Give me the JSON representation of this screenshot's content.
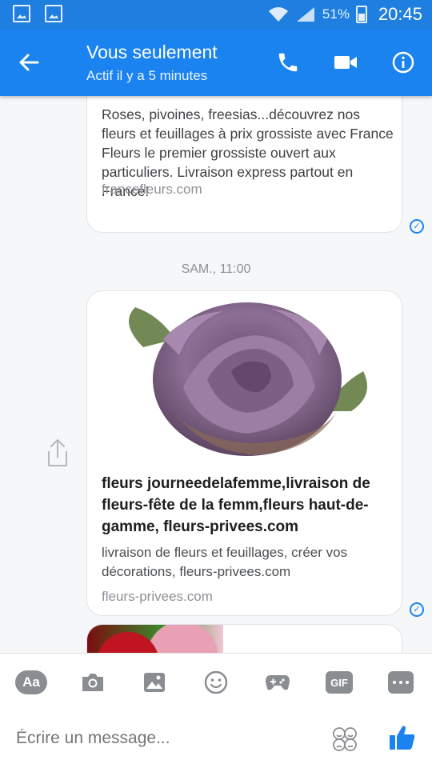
{
  "status_bar": {
    "battery": "51%",
    "time": "20:45"
  },
  "header": {
    "title": "Vous seulement",
    "subtitle": "Actif il y a 5 minutes"
  },
  "messages": [
    {
      "description": "Roses, pivoines, freesias...découvrez nos fleurs et feuillages à prix grossiste avec France Fleurs le premier grossiste ouvert aux particuliers. Livraison express partout en France!",
      "domain": "francefleurs.com"
    },
    {
      "timestamp": "SAM., 11:00",
      "title": "fleurs journeedelafemme,livraison de fleurs-fête de la femm,fleurs haut-de-gamme, fleurs-privees.com",
      "description": "livraison de fleurs et feuillages, créer vos décorations, fleurs-privees.com",
      "domain": "fleurs-privees.com"
    }
  ],
  "composer": {
    "aa_label": "Aa",
    "gif_label": "GIF",
    "placeholder": "Écrire un message..."
  },
  "colors": {
    "accent": "#1b83f0",
    "bubble_border": "#e1e3e6",
    "icon_gray": "#8a8d91"
  }
}
